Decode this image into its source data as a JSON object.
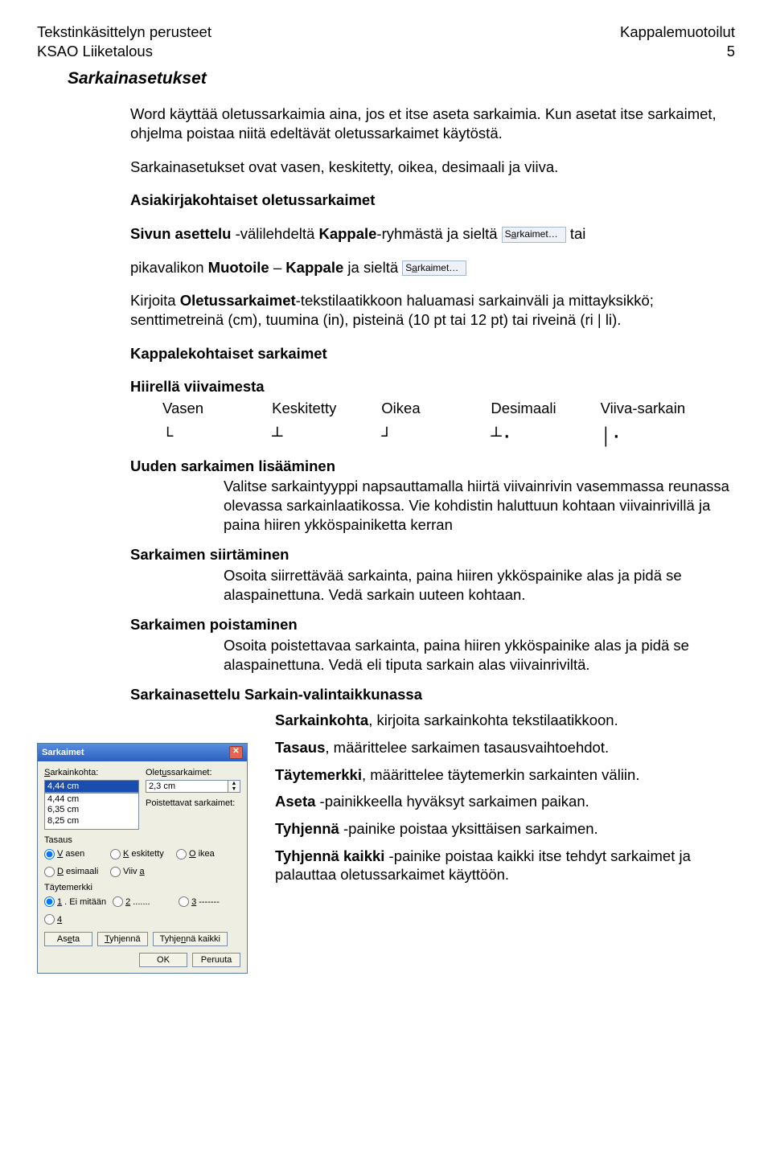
{
  "header": {
    "left1": "Tekstinkäsittelyn perusteet",
    "left2": "KSAO Liiketalous",
    "right1": "Kappalemuotoilut",
    "right2": "5"
  },
  "title": "Sarkainasetukset",
  "intro": {
    "p1": "Word käyttää oletussarkaimia aina, jos et itse aseta sarkaimia. Kun asetat itse sarkaimet, ohjelma poistaa niitä edeltävät oletussarkaimet käytöstä.",
    "p2": "Sarkainasetukset ovat vasen, keskitetty, oikea, desimaali ja viiva."
  },
  "h_defaults": "Asiakirjakohtaiset oletussarkaimet",
  "line_layout": {
    "a": "Sivun asettelu",
    "b": " -välilehdeltä ",
    "c": "Kappale",
    "d": "-ryhmästä ja sieltä ",
    "tai": " tai"
  },
  "btn_sarkaimet": "Sa̲rkaimet…",
  "line_quick": {
    "a": "pikavalikon ",
    "b": "Muotoile",
    "c": " – ",
    "d": "Kappale",
    "e": " ja sieltä "
  },
  "p_write": {
    "a": "Kirjoita ",
    "b": "Oletussarkaimet",
    "c": "-tekstilaatikkoon haluamasi sarkainväli ja mittayksikkö; senttimetreinä (cm), tuumina (in), pisteinä (10 pt tai 12 pt) tai riveinä (ri | li)."
  },
  "h_para": "Kappalekohtaiset sarkaimet",
  "h_ruler": "Hiirellä viivaimesta",
  "tab_types": {
    "labels": [
      "Vasen",
      "Keskitetty",
      "Oikea",
      "Desimaali",
      "Viiva-sarkain"
    ],
    "glyphs": [
      "└",
      "┴",
      "┘",
      "┴·",
      "│·"
    ]
  },
  "sub_add": "Uuden sarkaimen lisääminen",
  "sub_add_txt": "Valitse sarkaintyyppi napsauttamalla hiirtä viivainrivin vasemmassa reunassa olevassa sarkainlaatikossa. Vie kohdistin haluttuun kohtaan viivainrivillä ja paina hiiren ykköspainiketta kerran",
  "sub_move": "Sarkaimen siirtäminen",
  "sub_move_txt": "Osoita siirrettävää sarkainta, paina hiiren ykköspainike alas ja pidä se alaspainettuna. Vedä sarkain uuteen kohtaan.",
  "sub_del": "Sarkaimen poistaminen",
  "sub_del_txt": "Osoita poistettavaa sarkainta, paina hiiren ykköspainike alas ja pidä se alaspainettuna. Vedä eli tiputa sarkain alas viivainriviltä.",
  "sub_dlg": {
    "a": "Sarkainasettelu ",
    "b": "Sarkain",
    "c": "-valintaikkunassa"
  },
  "rlist": [
    {
      "b": "Sarkainkohta",
      "t": ", kirjoita sarkainkohta tekstilaatikkoon."
    },
    {
      "b": "Tasaus",
      "t": ", määrittelee sarkaimen tasausvaihtoehdot."
    },
    {
      "b": "Täytemerkki",
      "t": ", määrittelee täytemerkin sarkainten väliin."
    },
    {
      "b": "Aseta",
      "t": " -painikkeella hyväksyt sarkaimen paikan."
    },
    {
      "b": "Tyhjennä",
      "t": " -painike poistaa yksittäisen sarkaimen."
    },
    {
      "b": "Tyhjennä kaikki",
      "t": " -painike poistaa kaikki itse tehdyt sarkaimet ja palauttaa oletussarkaimet käyttöön."
    }
  ],
  "dialog": {
    "title": "Sarkaimet",
    "lbl_pos": "Sarkainkohta:",
    "lbl_def": "Oletussarkaimet:",
    "pos_val": "4,44 cm",
    "def_val": "2,3 cm",
    "lbl_remove": "Poistettavat sarkaimet:",
    "list": [
      "4,44 cm",
      "6,35 cm",
      "8,25 cm"
    ],
    "grp_align": "Tasaus",
    "align": [
      {
        "l": "Vasen",
        "c": true
      },
      {
        "l": "Keskitetty",
        "c": false
      },
      {
        "l": "Oikea",
        "c": false
      },
      {
        "l": "Desimaali",
        "c": false
      },
      {
        "l": "Viiva",
        "c": false
      }
    ],
    "grp_fill": "Täytemerkki",
    "fill": [
      {
        "l": "1. Ei mitään",
        "c": true
      },
      {
        "l": "2 .......",
        "c": false
      },
      {
        "l": "3 -------",
        "c": false
      },
      {
        "l": "4 ___",
        "c": false
      }
    ],
    "btn_set": "Aseta",
    "btn_clr": "Tyhjennä",
    "btn_clrall": "Tyhjennä kaikki",
    "btn_ok": "OK",
    "btn_cancel": "Peruuta"
  }
}
